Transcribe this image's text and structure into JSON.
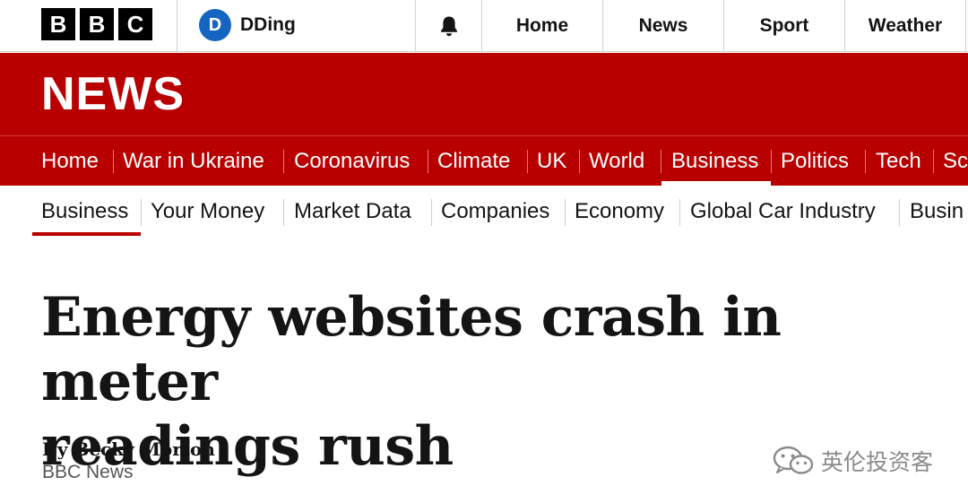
{
  "global_header": {
    "logo_letters": [
      "B",
      "B",
      "C"
    ],
    "account": {
      "initial": "D",
      "name": "DDing"
    },
    "notifications_icon": "bell-icon",
    "nav": [
      "Home",
      "News",
      "Sport",
      "Weather"
    ]
  },
  "section": {
    "wordmark": "NEWS"
  },
  "primary_nav": {
    "items": [
      "Home",
      "War in Ukraine",
      "Coronavirus",
      "Climate",
      "UK",
      "World",
      "Business",
      "Politics",
      "Tech",
      "Sc"
    ],
    "active": "Business"
  },
  "secondary_nav": {
    "items": [
      "Business",
      "Your Money",
      "Market Data",
      "Companies",
      "Economy",
      "Global Car Industry",
      "Busin"
    ],
    "active": "Business"
  },
  "article": {
    "headline_line1": "Energy websites crash in meter",
    "headline_line2": "readings rush",
    "author": "By Becky Morton",
    "outlet": "BBC News"
  },
  "watermark": {
    "text": "英伦投资客",
    "icon": "wechat-icon"
  },
  "colors": {
    "brand_red": "#b80000",
    "account_blue": "#1565c0"
  }
}
